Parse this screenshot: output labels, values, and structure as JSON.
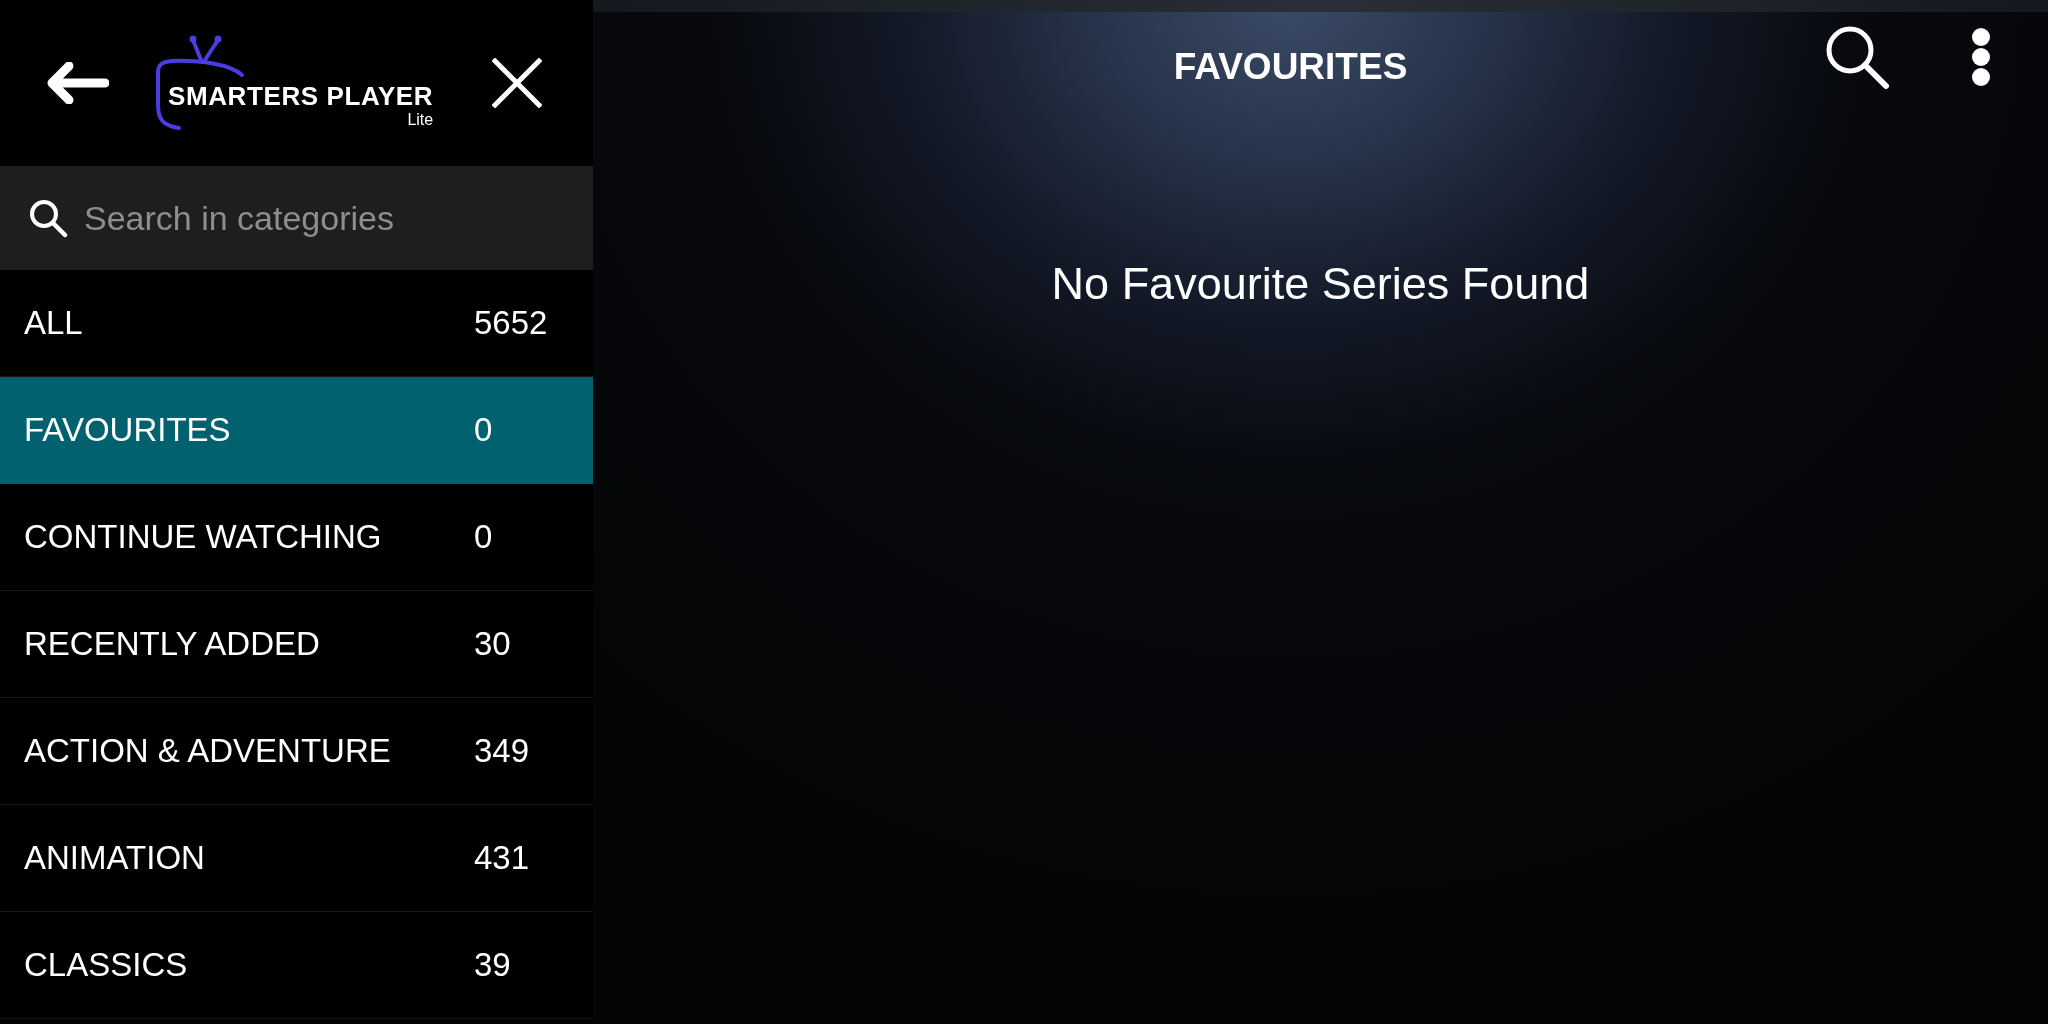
{
  "sidebar": {
    "logo": {
      "title": "SMARTERS PLAYER",
      "subtitle": "Lite"
    },
    "search": {
      "placeholder": "Search in categories"
    },
    "categories": [
      {
        "label": "ALL",
        "count": "5652",
        "selected": false
      },
      {
        "label": "FAVOURITES",
        "count": "0",
        "selected": true
      },
      {
        "label": "CONTINUE WATCHING",
        "count": "0",
        "selected": false
      },
      {
        "label": "RECENTLY ADDED",
        "count": "30",
        "selected": false
      },
      {
        "label": "ACTION & ADVENTURE",
        "count": "349",
        "selected": false
      },
      {
        "label": "ANIMATION",
        "count": "431",
        "selected": false
      },
      {
        "label": "CLASSICS",
        "count": "39",
        "selected": false
      }
    ]
  },
  "main": {
    "title": "FAVOURITES",
    "empty_message": "No Favourite Series Found"
  }
}
